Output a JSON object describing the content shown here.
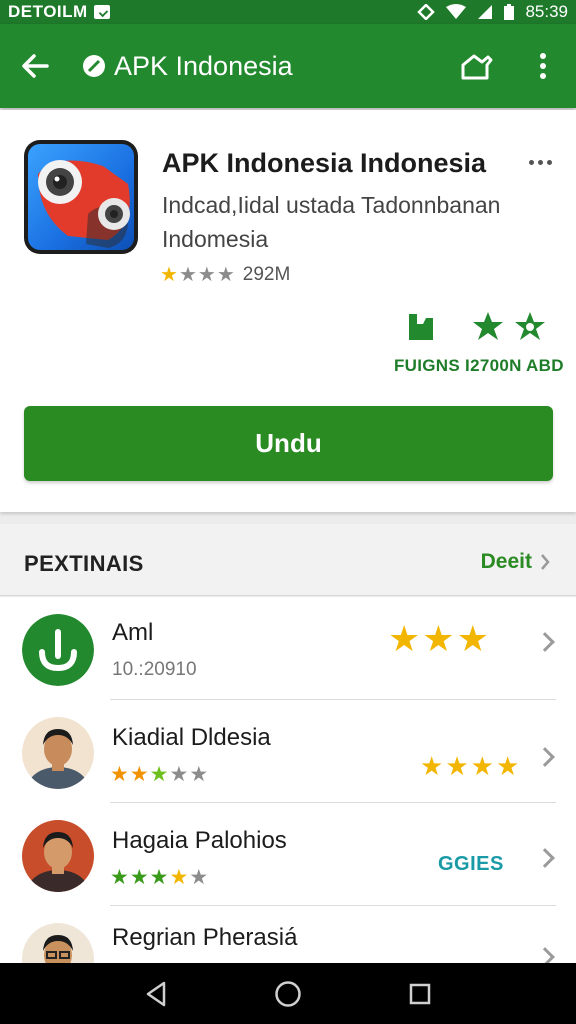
{
  "status_bar": {
    "left_text": "DETOILM",
    "time": "85:39"
  },
  "app_bar": {
    "title": "APK Indonesia"
  },
  "app": {
    "name": "APK Indonesia Indonesia",
    "description": "Indcad,Iidal ustada Tadonnbanan Indomesia",
    "rating_stars": 1,
    "rating_max": 5,
    "size": "292M",
    "badge_caption": "FUIGNS I2700N ABD",
    "install_label": "Undu"
  },
  "section": {
    "title": "PEXTINAIS",
    "link_label": "Deeit"
  },
  "list": [
    {
      "name": "Aml",
      "sub": "10.:20910",
      "avatar": "download-icon",
      "stars": 3.5,
      "tag": ""
    },
    {
      "name": "Kiadial Dldesia",
      "sub": "",
      "avatar": "person-1",
      "stars_small": 3,
      "stars": 4.5,
      "tag": ""
    },
    {
      "name": "Hagaia Palohios",
      "sub": "",
      "avatar": "person-2",
      "stars_small": 3.5,
      "stars": null,
      "tag": "GGIES"
    },
    {
      "name": "Regrian Pherasiá",
      "sub": "",
      "avatar": "person-3",
      "stars": null,
      "tag": ""
    }
  ],
  "colors": {
    "brand": "#23892f",
    "accent": "#2a8b22",
    "star": "#f3b600",
    "tag": "#1a9aa6"
  }
}
